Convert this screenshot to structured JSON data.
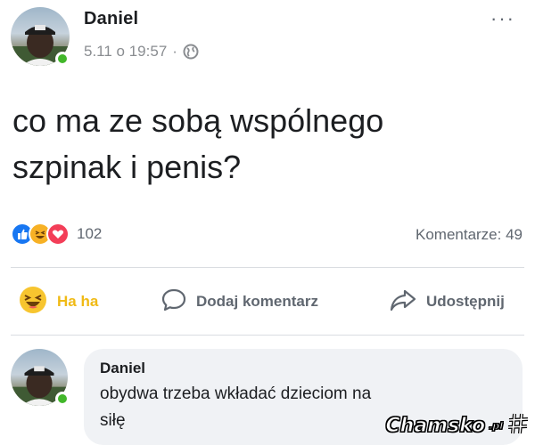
{
  "post": {
    "author": "Daniel",
    "timestamp": "5.11 o 19:57",
    "separator": "·",
    "audience_icon": "globe-icon",
    "more_label": "···",
    "text_line1": "co ma ze sobą wspólnego",
    "text_line2": "szpinak i penis?"
  },
  "reactions": {
    "icons": [
      "like-icon",
      "haha-icon",
      "love-icon"
    ],
    "count": "102",
    "comments_label": "Komentarze: 49"
  },
  "actions": {
    "haha_label": "Ha ha",
    "comment_label": "Dodaj komentarz",
    "share_label": "Udostępnij"
  },
  "comment": {
    "author": "Daniel",
    "text_line1": "obydwa trzeba wkładać dzieciom na",
    "text_line2": "siłę"
  },
  "watermark": {
    "text": "Chamsko",
    "suffix": ".pl"
  },
  "colors": {
    "online": "#42b72a",
    "like": "#1877f2",
    "haha": "#f7b125",
    "love": "#f33e58",
    "muted": "#606770"
  }
}
